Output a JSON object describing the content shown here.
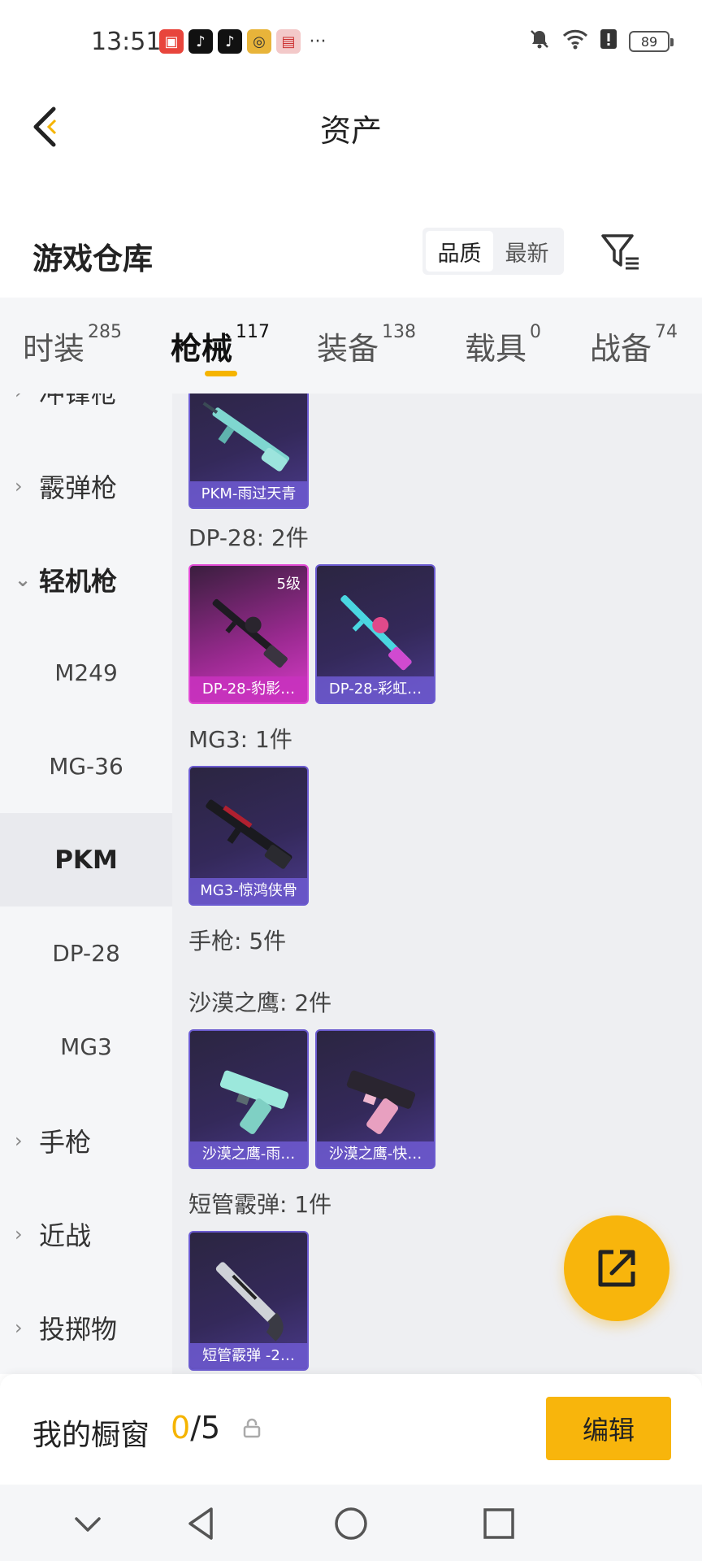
{
  "status_bar": {
    "time": "13:51",
    "notification_icons": [
      "huawei-app-icon",
      "tiktok-icon",
      "tiktok-icon",
      "game-app-icon",
      "box-app-icon"
    ],
    "more": "···",
    "battery": "89"
  },
  "header": {
    "title": "资产"
  },
  "section": {
    "title": "游戏仓库",
    "sort_options": [
      "品质",
      "最新"
    ],
    "active_sort": "品质"
  },
  "tabs": [
    {
      "label": "时装",
      "count": "285"
    },
    {
      "label": "枪械",
      "count": "117"
    },
    {
      "label": "装备",
      "count": "138"
    },
    {
      "label": "载具",
      "count": "0"
    },
    {
      "label": "战备",
      "count": "74"
    }
  ],
  "sidebar": {
    "items": [
      {
        "label": "冲锋枪",
        "type": "parent",
        "chevron": "›"
      },
      {
        "label": "霰弹枪",
        "type": "parent",
        "chevron": "›"
      },
      {
        "label": "轻机枪",
        "type": "parent",
        "chevron": "⌄"
      },
      {
        "label": "M249",
        "type": "child"
      },
      {
        "label": "MG-36",
        "type": "child"
      },
      {
        "label": "PKM",
        "type": "child"
      },
      {
        "label": "DP-28",
        "type": "child"
      },
      {
        "label": "MG3",
        "type": "child"
      },
      {
        "label": "手枪",
        "type": "parent",
        "chevron": "›"
      },
      {
        "label": "近战",
        "type": "parent",
        "chevron": "›"
      },
      {
        "label": "投掷物",
        "type": "parent",
        "chevron": "›"
      }
    ]
  },
  "groups": [
    {
      "label": "",
      "items": [
        {
          "name": "PKM-雨过天青"
        }
      ]
    },
    {
      "label": "DP-28: 2件",
      "items": [
        {
          "name": "DP-28-豹影…",
          "level": "5级"
        },
        {
          "name": "DP-28-彩虹…"
        }
      ]
    },
    {
      "label": "MG3: 1件",
      "items": [
        {
          "name": "MG3-惊鸿侠骨"
        }
      ]
    },
    {
      "label": "手枪: 5件",
      "items": []
    },
    {
      "label": "沙漠之鹰: 2件",
      "items": [
        {
          "name": "沙漠之鹰-雨…"
        },
        {
          "name": "沙漠之鹰-快…"
        }
      ]
    },
    {
      "label": "短管霰弹: 1件",
      "items": [
        {
          "name": "短管霰弹 -2…"
        }
      ]
    }
  ],
  "showcase": {
    "title": "我的橱窗",
    "current": "0",
    "total": "/5",
    "edit_label": "编辑"
  },
  "colors": {
    "accent": "#f8b50c",
    "card_purple": "#6b5bd0",
    "card_gold": "#e14ad4"
  }
}
